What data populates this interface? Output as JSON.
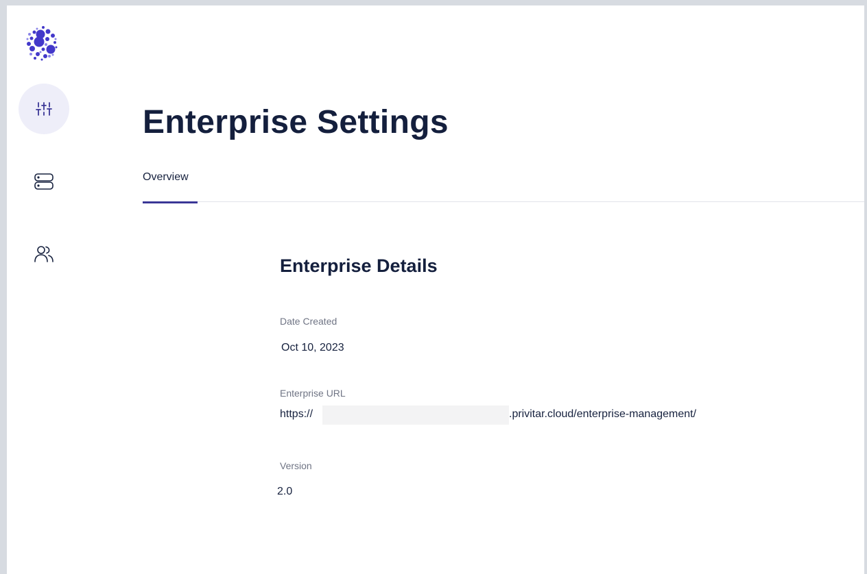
{
  "sidebar": {
    "logo_icon": "dots-circle-logo",
    "nav": [
      {
        "icon": "sliders-icon",
        "active": true
      },
      {
        "icon": "server-icon",
        "active": false
      },
      {
        "icon": "users-icon",
        "active": false
      }
    ]
  },
  "page": {
    "title": "Enterprise Settings",
    "tabs": [
      {
        "label": "Overview",
        "active": true
      }
    ]
  },
  "details": {
    "title": "Enterprise Details",
    "date_created": {
      "label": "Date Created",
      "value": "Oct 10, 2023"
    },
    "enterprise_url": {
      "label": "Enterprise URL",
      "prefix": "https://",
      "suffix": ".privitar.cloud/enterprise-management/"
    },
    "version": {
      "label": "Version",
      "value": "2.0"
    }
  },
  "colors": {
    "accent": "#3a3696",
    "logo": "#4338ca",
    "nav_active_bg": "#eeeef9",
    "text": "#16213e"
  }
}
